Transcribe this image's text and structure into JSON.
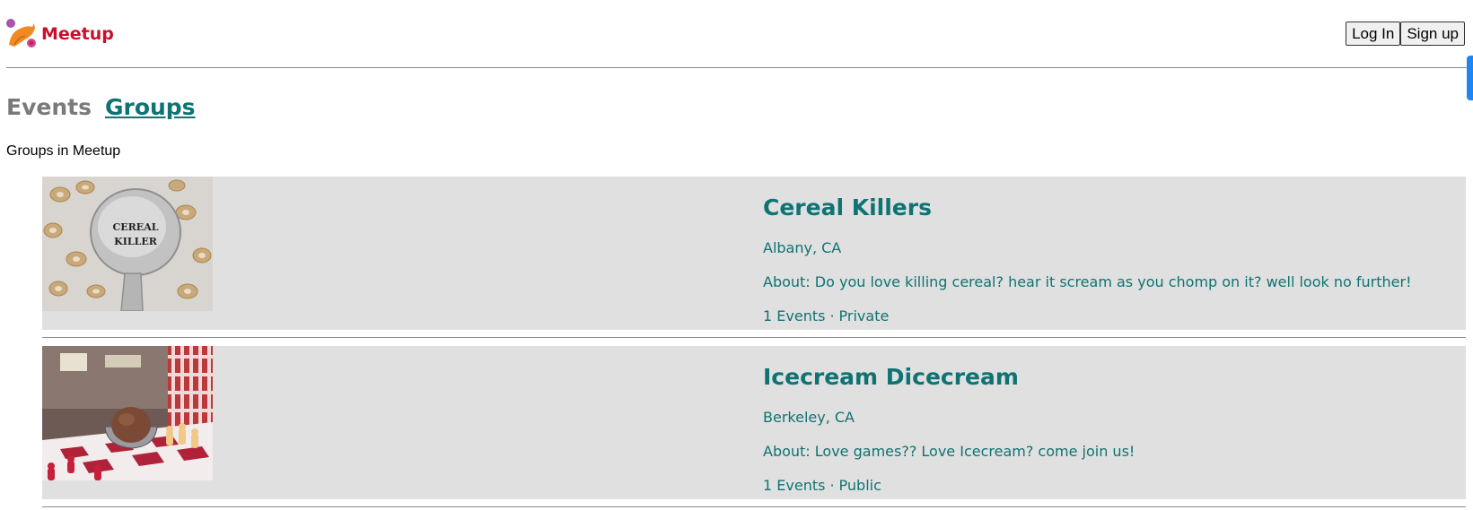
{
  "header": {
    "brand": "Meetup",
    "logo_icon": "cat-logo-icon",
    "login_label": "Log In",
    "signup_label": "Sign up"
  },
  "tabs": {
    "events_label": "Events",
    "groups_label": "Groups"
  },
  "page": {
    "subtitle": "Groups in Meetup"
  },
  "groups": [
    {
      "title": "Cereal Killers",
      "location": "Albany, CA",
      "about": "About: Do you love killing cereal? hear it scream as you chomp on it? well look no further!",
      "events": "1 Events",
      "separator": "·",
      "privacy": "Private",
      "image_text_line1": "CEREAL",
      "image_text_line2": "KILLER"
    },
    {
      "title": "Icecream Dicecream",
      "location": "Berkeley, CA",
      "about": "About: Love games?? Love Icecream? come join us!",
      "events": "1 Events",
      "separator": "·",
      "privacy": "Public"
    }
  ],
  "colors": {
    "brand": "#c8102e",
    "accent_teal": "#0f7373",
    "card_bg": "#e0e0e0",
    "muted_tab": "#7a7a7a",
    "scroll_indicator": "#1e86f0"
  }
}
